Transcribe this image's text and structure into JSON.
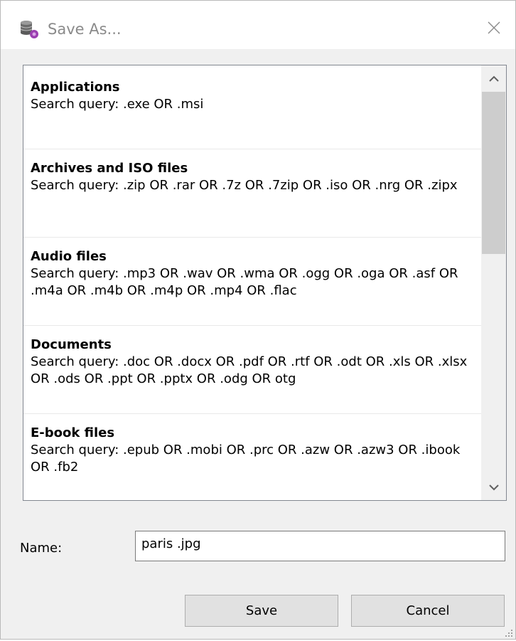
{
  "window": {
    "title": "Save As..."
  },
  "list": {
    "items": [
      {
        "title": "Applications",
        "query": "Search query: .exe OR .msi"
      },
      {
        "title": "Archives and ISO files",
        "query": "Search query: .zip OR .rar OR .7z OR .7zip OR .iso OR .nrg OR .zipx"
      },
      {
        "title": "Audio files",
        "query": "Search query: .mp3 OR .wav OR .wma OR .ogg OR .oga OR .asf OR .m4a OR .m4b OR .m4p OR .mp4 OR .flac"
      },
      {
        "title": "Documents",
        "query": "Search query: .doc OR .docx OR .pdf OR .rtf OR .odt OR .xls OR .xlsx OR .ods OR .ppt OR .pptx OR .odg OR otg"
      },
      {
        "title": "E-book files",
        "query": "Search query: .epub OR .mobi OR .prc OR .azw OR .azw3 OR .ibook OR .fb2"
      },
      {
        "title": "",
        "query": ""
      }
    ]
  },
  "form": {
    "name_label": "Name:",
    "name_value": "paris .jpg"
  },
  "buttons": {
    "save_label": "Save",
    "cancel_label": "Cancel"
  },
  "icons": {
    "app": "database-icon",
    "close": "close-icon",
    "scroll_up": "chevron-up-icon",
    "scroll_down": "chevron-down-icon",
    "grip": "resize-grip-icon"
  }
}
